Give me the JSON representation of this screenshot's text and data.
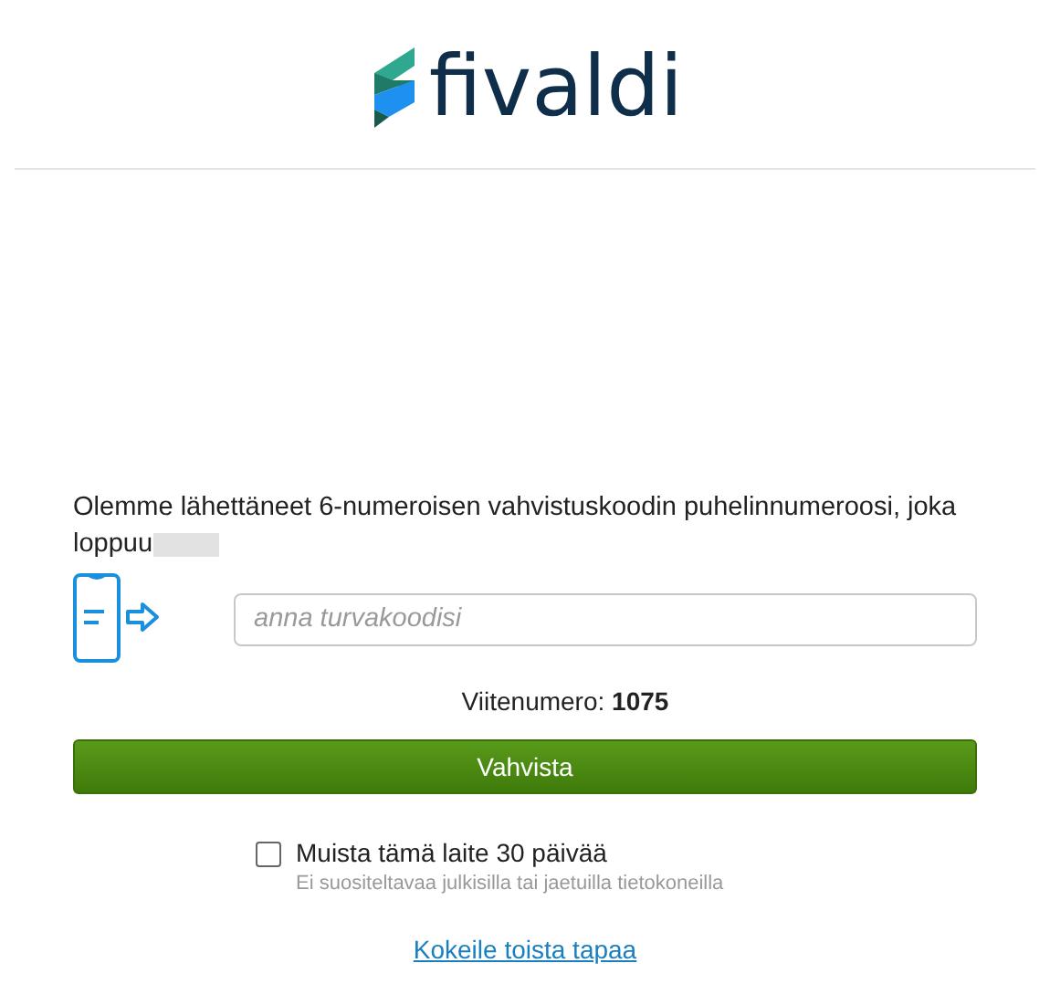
{
  "header": {
    "logo_text": "fivaldi"
  },
  "intro": {
    "text": "Olemme lähettäneet 6-numeroisen vahvistuskoodin puhelinnumeroosi, joka loppuu",
    "redacted": true
  },
  "code_field": {
    "placeholder": "anna turvakoodisi"
  },
  "reference": {
    "label": "Viitenumero:",
    "value": "1075"
  },
  "confirm_button": {
    "label": "Vahvista"
  },
  "remember": {
    "label": "Muista tämä laite 30 päivää",
    "hint": "Ei suositeltavaa julkisilla tai jaetuilla tietokoneilla",
    "checked": false
  },
  "alt_link": {
    "label": "Kokeile toista tapaa"
  }
}
